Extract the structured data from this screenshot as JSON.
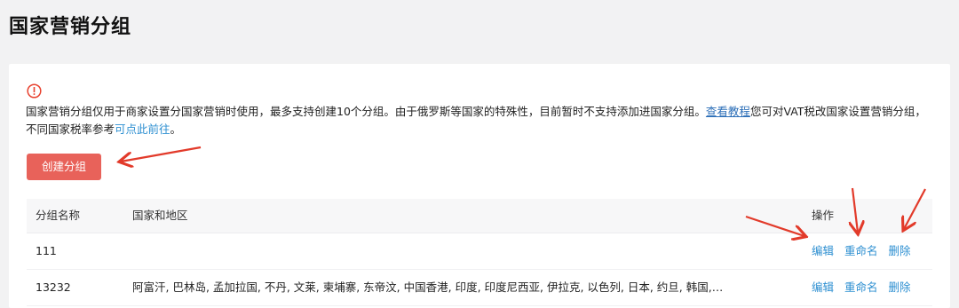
{
  "page": {
    "title": "国家营销分组"
  },
  "notice": {
    "icon": "warning-circle-icon",
    "text_before": "国家营销分组仅用于商家设置分国家营销时使用，最多支持创建10个分组。由于俄罗斯等国家的特殊性，目前暂时不支持添加进国家分组。",
    "tutorial_link": "查看教程",
    "text_middle": "您可对VAT税改国家设置营销分组，不同国家税率参考",
    "rate_link": "可点此前往",
    "text_after": "。"
  },
  "toolbar": {
    "create_label": "创建分组"
  },
  "table": {
    "columns": {
      "name": "分组名称",
      "countries": "国家和地区",
      "ops": "操作"
    },
    "rows": [
      {
        "name": "111",
        "countries": "",
        "actions": {
          "edit": "编辑",
          "rename": "重命名",
          "delete": "删除"
        }
      },
      {
        "name": "13232",
        "countries": "阿富汗, 巴林岛, 孟加拉国, 不丹, 文莱, 柬埔寨, 东帝汶, 中国香港, 印度, 印度尼西亚, 伊拉克, 以色列, 日本, 约旦, 韩国,…",
        "actions": {
          "edit": "编辑",
          "rename": "重命名",
          "delete": "删除"
        }
      }
    ]
  },
  "colors": {
    "accent": "#e8625a",
    "link": "#2d8fd1",
    "annotation_arrow": "#e23a2a",
    "warning": "#e8412e"
  }
}
